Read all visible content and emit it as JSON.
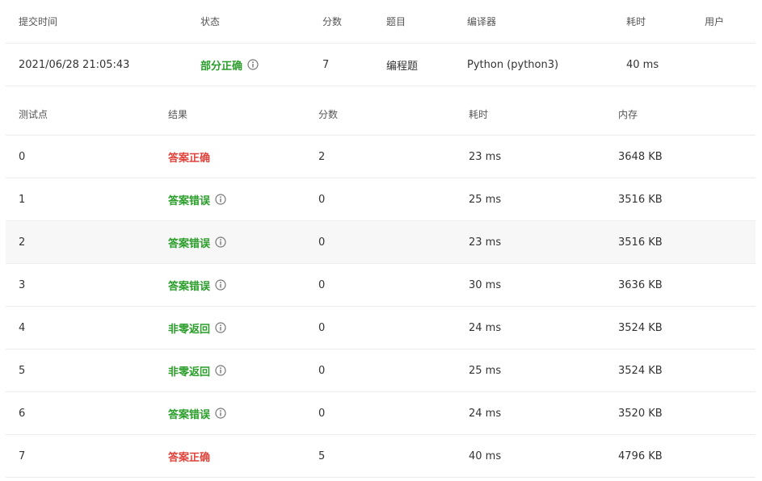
{
  "colors": {
    "partial": "#2a9d2a",
    "correct": "#e0433b",
    "wrong": "#2a9d2a",
    "icon": "#777777"
  },
  "submission": {
    "headers": {
      "time": "提交时间",
      "status": "状态",
      "score": "分数",
      "problem": "题目",
      "compiler": "编译器",
      "elapsed": "耗时",
      "user": "用户"
    },
    "row": {
      "time": "2021/06/28 21:05:43",
      "status": "部分正确",
      "status_type": "partial",
      "score": "7",
      "problem": "编程题",
      "compiler": "Python (python3)",
      "elapsed": "40 ms",
      "user": ""
    }
  },
  "testcases": {
    "headers": {
      "case": "测试点",
      "result": "结果",
      "score": "分数",
      "elapsed": "耗时",
      "memory": "内存"
    },
    "rows": [
      {
        "case": "0",
        "result": "答案正确",
        "result_type": "correct",
        "info_icon": false,
        "score": "2",
        "elapsed": "23 ms",
        "memory": "3648 KB"
      },
      {
        "case": "1",
        "result": "答案错误",
        "result_type": "wrong",
        "info_icon": true,
        "score": "0",
        "elapsed": "25 ms",
        "memory": "3516 KB"
      },
      {
        "case": "2",
        "result": "答案错误",
        "result_type": "wrong",
        "info_icon": true,
        "score": "0",
        "elapsed": "23 ms",
        "memory": "3516 KB"
      },
      {
        "case": "3",
        "result": "答案错误",
        "result_type": "wrong",
        "info_icon": true,
        "score": "0",
        "elapsed": "30 ms",
        "memory": "3636 KB"
      },
      {
        "case": "4",
        "result": "非零返回",
        "result_type": "wrong",
        "info_icon": true,
        "score": "0",
        "elapsed": "24 ms",
        "memory": "3524 KB"
      },
      {
        "case": "5",
        "result": "非零返回",
        "result_type": "wrong",
        "info_icon": true,
        "score": "0",
        "elapsed": "25 ms",
        "memory": "3524 KB"
      },
      {
        "case": "6",
        "result": "答案错误",
        "result_type": "wrong",
        "info_icon": true,
        "score": "0",
        "elapsed": "24 ms",
        "memory": "3520 KB"
      },
      {
        "case": "7",
        "result": "答案正确",
        "result_type": "correct",
        "info_icon": false,
        "score": "5",
        "elapsed": "40 ms",
        "memory": "4796 KB"
      }
    ]
  }
}
